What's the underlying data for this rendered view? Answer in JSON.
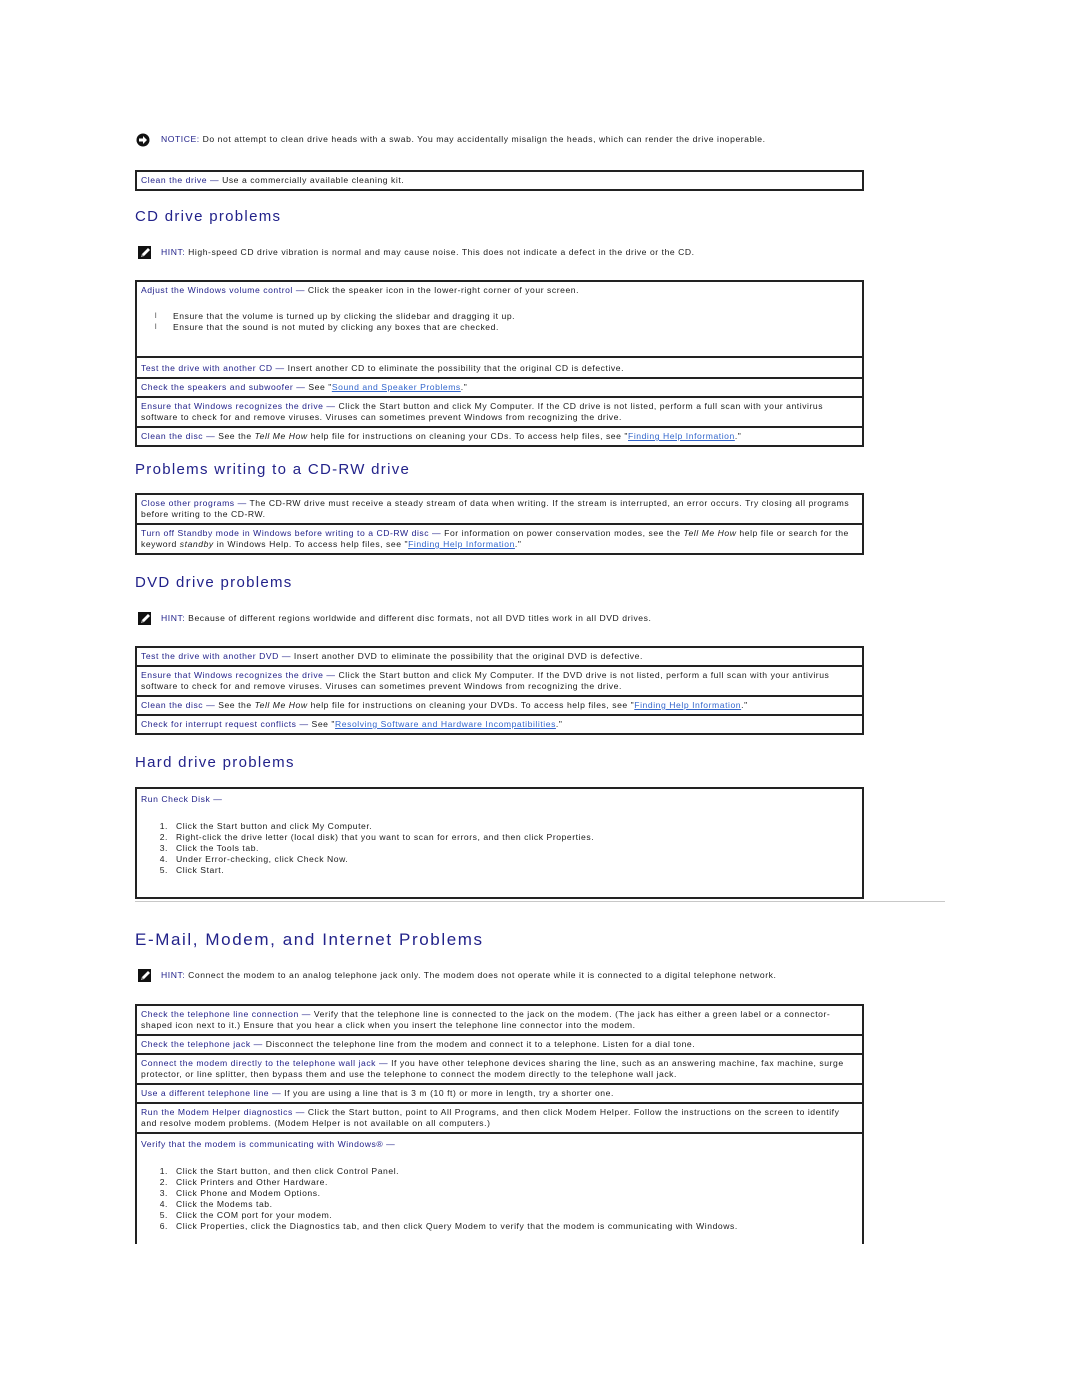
{
  "colors": {
    "heading": "#22228a",
    "term": "#22228a",
    "link": "#3366cc",
    "border": "#222222",
    "rule": "#c8c8c8"
  },
  "notice": {
    "icon": "notice-arrow-icon",
    "label": "NOTICE:",
    "text": " Do not attempt to clean drive heads with a swab. You may accidentally misalign the heads, which can render the drive inoperable."
  },
  "clean_drive": {
    "term": "Clean the drive — ",
    "text": "Use a commercially available cleaning kit."
  },
  "cd_section": {
    "title": "CD drive problems",
    "hint": {
      "icon": "hint-pencil-icon",
      "label": "HINT:",
      "text": " High-speed CD drive vibration is normal and may cause noise. This does not indicate a defect in the drive or the CD."
    },
    "rows": [
      {
        "term": "Adjust the Windows volume control — ",
        "text": "Click the speaker icon in the lower-right corner of your screen.",
        "bullets": [
          "Ensure that the volume is turned up by clicking the slidebar and dragging it up.",
          "Ensure that the sound is not muted by clicking any boxes that are checked."
        ]
      },
      {
        "term": "Test the drive with another CD — ",
        "text": "Insert another CD to eliminate the possibility that the original CD is defective."
      },
      {
        "term": "Check the speakers and subwoofer — ",
        "pre": "See \"",
        "link": "Sound and Speaker Problems",
        "post": ".\""
      },
      {
        "term": "Ensure that Windows recognizes the drive — ",
        "text": "Click the Start button and click My Computer. If the CD drive is not listed, perform a full scan with your antivirus software to check for and remove viruses. Viruses can sometimes prevent Windows from recognizing the drive."
      },
      {
        "term": "Clean the disc — ",
        "pre": "See the ",
        "italic": "Tell Me How",
        "mid": " help file for instructions on cleaning your CDs. To access help files, see \"",
        "link": "Finding Help Information",
        "post": ".\""
      }
    ]
  },
  "cdrw_section": {
    "title": "Problems writing to a CD-RW drive",
    "rows": [
      {
        "term": "Close other programs — ",
        "text": "The CD-RW drive must receive a steady stream of data when writing. If the stream is interrupted, an error occurs. Try closing all programs before writing to the CD-RW."
      },
      {
        "term": "Turn off Standby mode in Windows before writing to a CD-RW disc — ",
        "pre": "For information on power conservation modes, see the ",
        "italic": "Tell Me How",
        "mid": " help file or search for the keyword ",
        "italic2": "standby",
        "mid2": " in Windows Help. To access help files, see \"",
        "link": "Finding Help Information",
        "post": ".\""
      }
    ]
  },
  "dvd_section": {
    "title": "DVD drive problems",
    "hint": {
      "icon": "hint-pencil-icon",
      "label": "HINT:",
      "text": " Because of different regions worldwide and different disc formats, not all DVD titles work in all DVD drives."
    },
    "rows": [
      {
        "term": "Test the drive with another DVD — ",
        "text": "Insert another DVD to eliminate the possibility that the original DVD is defective."
      },
      {
        "term": "Ensure that Windows recognizes the drive — ",
        "text": "Click the Start button and click My Computer. If the DVD drive is not listed, perform a full scan with your antivirus software to check for and remove viruses. Viruses can sometimes prevent Windows from recognizing the drive."
      },
      {
        "term": "Clean the disc — ",
        "pre": "See the ",
        "italic": "Tell Me How",
        "mid": " help file for instructions on cleaning your DVDs. To access help files, see \"",
        "link": "Finding Help Information",
        "post": ".\""
      },
      {
        "term": "Check for interrupt request conflicts — ",
        "pre": "See \"",
        "link": "Resolving Software and Hardware Incompatibilities",
        "post": ".\""
      }
    ]
  },
  "hd_section": {
    "title": "Hard drive problems",
    "row": {
      "term": "Run Check Disk — ",
      "steps": [
        "Click the Start button and click My Computer.",
        "Right-click the drive letter (local disk) that you want to scan for errors, and then click Properties.",
        "Click the Tools tab.",
        "Under Error-checking, click Check Now.",
        "Click Start."
      ]
    }
  },
  "email_section": {
    "title": "E-Mail, Modem, and Internet Problems",
    "hint": {
      "icon": "hint-pencil-icon",
      "label": "HINT:",
      "text": " Connect the modem to an analog telephone jack only. The modem does not operate while it is connected to a digital telephone network."
    },
    "rows": [
      {
        "term": "Check the telephone line connection — ",
        "text": "Verify that the telephone line is connected to the jack on the modem. (The jack has either a green label or a connector-shaped icon next to it.) Ensure that you hear a click when you insert the telephone line connector into the modem."
      },
      {
        "term": "Check the telephone jack — ",
        "text": "Disconnect the telephone line from the modem and connect it to a telephone. Listen for a dial tone."
      },
      {
        "term": "Connect the modem directly to the telephone wall jack — ",
        "text": "If you have other telephone devices sharing the line, such as an answering machine, fax machine, surge protector, or line splitter, then bypass them and use the telephone to connect the modem directly to the telephone wall jack."
      },
      {
        "term": "Use a different telephone line — ",
        "text": "If you are using a line that is 3 m (10 ft) or more in length, try a shorter one."
      },
      {
        "term": "Run the Modem Helper diagnostics — ",
        "text": "Click the Start button, point to All Programs, and then click Modem Helper. Follow the instructions on the screen to identify and resolve modem problems. (Modem Helper is not available on all computers.)"
      },
      {
        "term": "Verify that the modem is communicating with Windows® — ",
        "steps": [
          "Click the Start button, and then click Control Panel.",
          "Click Printers and Other Hardware.",
          "Click Phone and Modem Options.",
          "Click the Modems tab.",
          "Click the COM port for your modem.",
          "Click Properties, click the Diagnostics tab, and then click Query Modem to verify that the modem is communicating with Windows."
        ]
      }
    ]
  },
  "bullet_glyph": "l"
}
